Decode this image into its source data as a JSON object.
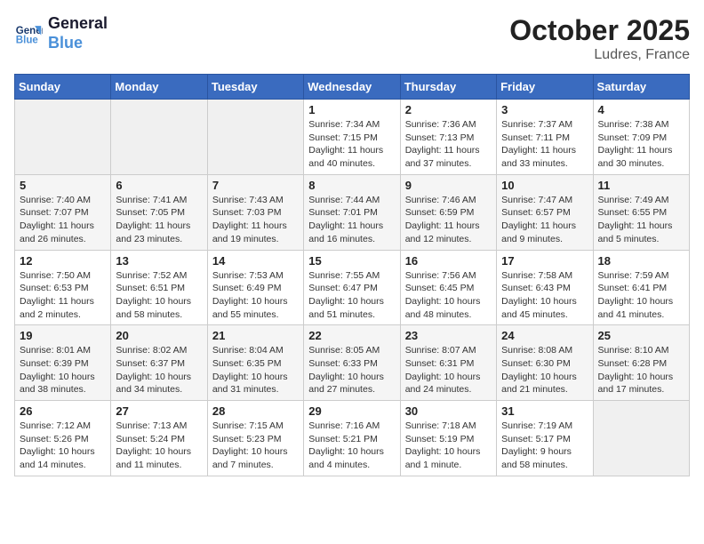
{
  "header": {
    "logo_line1": "General",
    "logo_line2": "Blue",
    "month": "October 2025",
    "location": "Ludres, France"
  },
  "days_of_week": [
    "Sunday",
    "Monday",
    "Tuesday",
    "Wednesday",
    "Thursday",
    "Friday",
    "Saturday"
  ],
  "weeks": [
    [
      {
        "day": "",
        "info": ""
      },
      {
        "day": "",
        "info": ""
      },
      {
        "day": "",
        "info": ""
      },
      {
        "day": "1",
        "info": "Sunrise: 7:34 AM\nSunset: 7:15 PM\nDaylight: 11 hours and 40 minutes."
      },
      {
        "day": "2",
        "info": "Sunrise: 7:36 AM\nSunset: 7:13 PM\nDaylight: 11 hours and 37 minutes."
      },
      {
        "day": "3",
        "info": "Sunrise: 7:37 AM\nSunset: 7:11 PM\nDaylight: 11 hours and 33 minutes."
      },
      {
        "day": "4",
        "info": "Sunrise: 7:38 AM\nSunset: 7:09 PM\nDaylight: 11 hours and 30 minutes."
      }
    ],
    [
      {
        "day": "5",
        "info": "Sunrise: 7:40 AM\nSunset: 7:07 PM\nDaylight: 11 hours and 26 minutes."
      },
      {
        "day": "6",
        "info": "Sunrise: 7:41 AM\nSunset: 7:05 PM\nDaylight: 11 hours and 23 minutes."
      },
      {
        "day": "7",
        "info": "Sunrise: 7:43 AM\nSunset: 7:03 PM\nDaylight: 11 hours and 19 minutes."
      },
      {
        "day": "8",
        "info": "Sunrise: 7:44 AM\nSunset: 7:01 PM\nDaylight: 11 hours and 16 minutes."
      },
      {
        "day": "9",
        "info": "Sunrise: 7:46 AM\nSunset: 6:59 PM\nDaylight: 11 hours and 12 minutes."
      },
      {
        "day": "10",
        "info": "Sunrise: 7:47 AM\nSunset: 6:57 PM\nDaylight: 11 hours and 9 minutes."
      },
      {
        "day": "11",
        "info": "Sunrise: 7:49 AM\nSunset: 6:55 PM\nDaylight: 11 hours and 5 minutes."
      }
    ],
    [
      {
        "day": "12",
        "info": "Sunrise: 7:50 AM\nSunset: 6:53 PM\nDaylight: 11 hours and 2 minutes."
      },
      {
        "day": "13",
        "info": "Sunrise: 7:52 AM\nSunset: 6:51 PM\nDaylight: 10 hours and 58 minutes."
      },
      {
        "day": "14",
        "info": "Sunrise: 7:53 AM\nSunset: 6:49 PM\nDaylight: 10 hours and 55 minutes."
      },
      {
        "day": "15",
        "info": "Sunrise: 7:55 AM\nSunset: 6:47 PM\nDaylight: 10 hours and 51 minutes."
      },
      {
        "day": "16",
        "info": "Sunrise: 7:56 AM\nSunset: 6:45 PM\nDaylight: 10 hours and 48 minutes."
      },
      {
        "day": "17",
        "info": "Sunrise: 7:58 AM\nSunset: 6:43 PM\nDaylight: 10 hours and 45 minutes."
      },
      {
        "day": "18",
        "info": "Sunrise: 7:59 AM\nSunset: 6:41 PM\nDaylight: 10 hours and 41 minutes."
      }
    ],
    [
      {
        "day": "19",
        "info": "Sunrise: 8:01 AM\nSunset: 6:39 PM\nDaylight: 10 hours and 38 minutes."
      },
      {
        "day": "20",
        "info": "Sunrise: 8:02 AM\nSunset: 6:37 PM\nDaylight: 10 hours and 34 minutes."
      },
      {
        "day": "21",
        "info": "Sunrise: 8:04 AM\nSunset: 6:35 PM\nDaylight: 10 hours and 31 minutes."
      },
      {
        "day": "22",
        "info": "Sunrise: 8:05 AM\nSunset: 6:33 PM\nDaylight: 10 hours and 27 minutes."
      },
      {
        "day": "23",
        "info": "Sunrise: 8:07 AM\nSunset: 6:31 PM\nDaylight: 10 hours and 24 minutes."
      },
      {
        "day": "24",
        "info": "Sunrise: 8:08 AM\nSunset: 6:30 PM\nDaylight: 10 hours and 21 minutes."
      },
      {
        "day": "25",
        "info": "Sunrise: 8:10 AM\nSunset: 6:28 PM\nDaylight: 10 hours and 17 minutes."
      }
    ],
    [
      {
        "day": "26",
        "info": "Sunrise: 7:12 AM\nSunset: 5:26 PM\nDaylight: 10 hours and 14 minutes."
      },
      {
        "day": "27",
        "info": "Sunrise: 7:13 AM\nSunset: 5:24 PM\nDaylight: 10 hours and 11 minutes."
      },
      {
        "day": "28",
        "info": "Sunrise: 7:15 AM\nSunset: 5:23 PM\nDaylight: 10 hours and 7 minutes."
      },
      {
        "day": "29",
        "info": "Sunrise: 7:16 AM\nSunset: 5:21 PM\nDaylight: 10 hours and 4 minutes."
      },
      {
        "day": "30",
        "info": "Sunrise: 7:18 AM\nSunset: 5:19 PM\nDaylight: 10 hours and 1 minute."
      },
      {
        "day": "31",
        "info": "Sunrise: 7:19 AM\nSunset: 5:17 PM\nDaylight: 9 hours and 58 minutes."
      },
      {
        "day": "",
        "info": ""
      }
    ]
  ]
}
